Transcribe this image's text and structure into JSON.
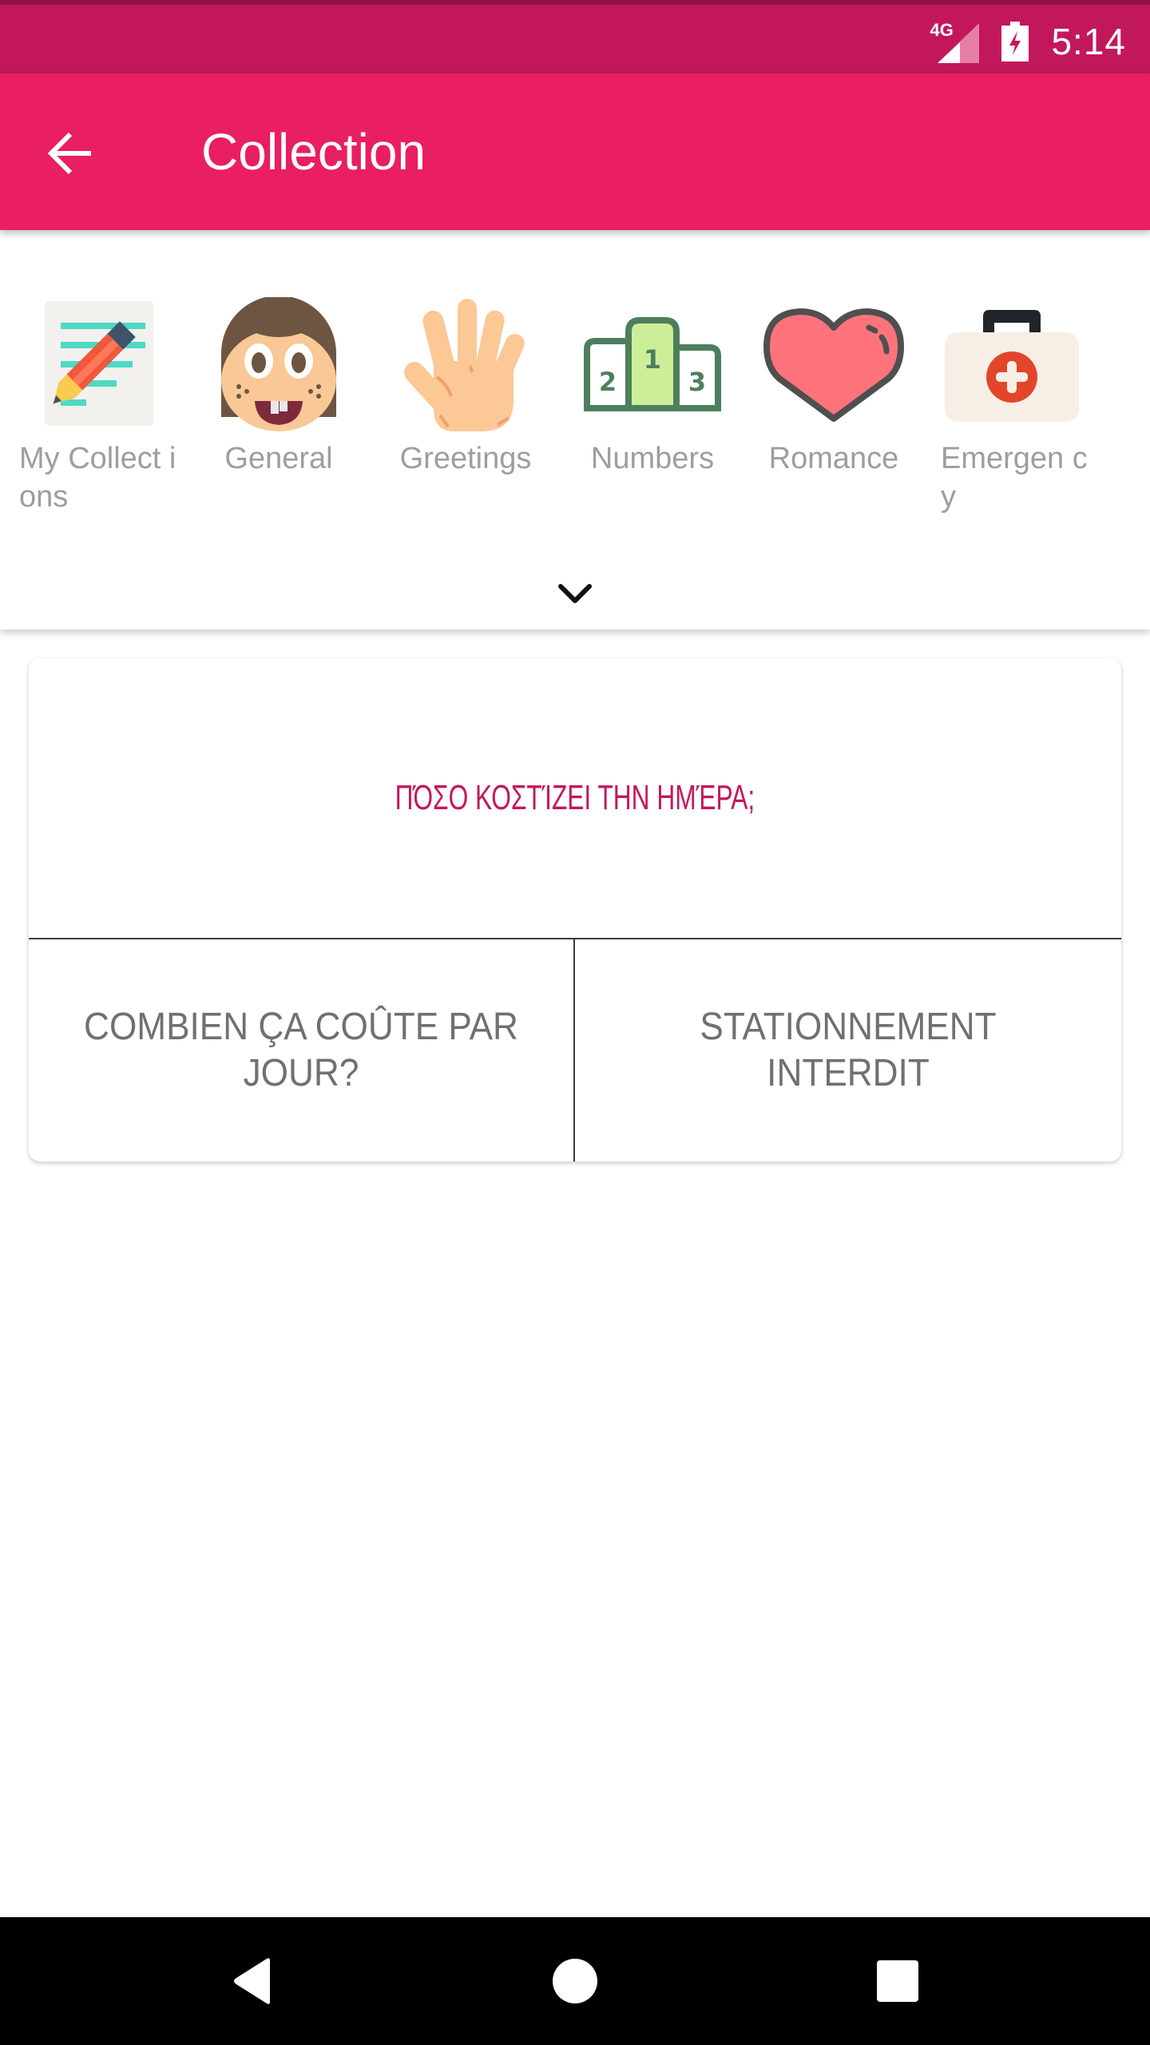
{
  "status_bar": {
    "network": "4G",
    "time": "5:14",
    "icons": [
      "signal-icon",
      "battery-charging-icon"
    ]
  },
  "app_bar": {
    "title": "Collection",
    "back_icon": "arrow-back-icon"
  },
  "categories": [
    {
      "label": "My Collections",
      "display": "My Collect ions",
      "icon": "notepad-pencil-icon"
    },
    {
      "label": "General",
      "display": "General",
      "icon": "smiling-face-icon"
    },
    {
      "label": "Greetings",
      "display": "Greetings",
      "icon": "waving-hand-icon"
    },
    {
      "label": "Numbers",
      "display": "Numbers",
      "icon": "podium-icon"
    },
    {
      "label": "Romance",
      "display": "Romance",
      "icon": "heart-icon"
    },
    {
      "label": "Emergency",
      "display": "Emergen cy",
      "icon": "first-aid-kit-icon"
    }
  ],
  "expand_icon": "chevron-down-icon",
  "phrase_card": {
    "question": "ΠΌΣΟ ΚΟΣΤΊΖΕΙ ΤΗΝ ΗΜΈΡΑ;",
    "answers": [
      "COMBIEN ÇA COÛTE PAR JOUR?",
      "STATIONNEMENT INTERDIT"
    ]
  },
  "colors": {
    "status_bar": "#c2185b",
    "app_bar": "#e91e63",
    "question_text": "#c2185b",
    "answer_text": "#707070",
    "category_label": "#9e9e9e"
  },
  "nav_bar": {
    "buttons": [
      "back",
      "home",
      "recents"
    ]
  }
}
